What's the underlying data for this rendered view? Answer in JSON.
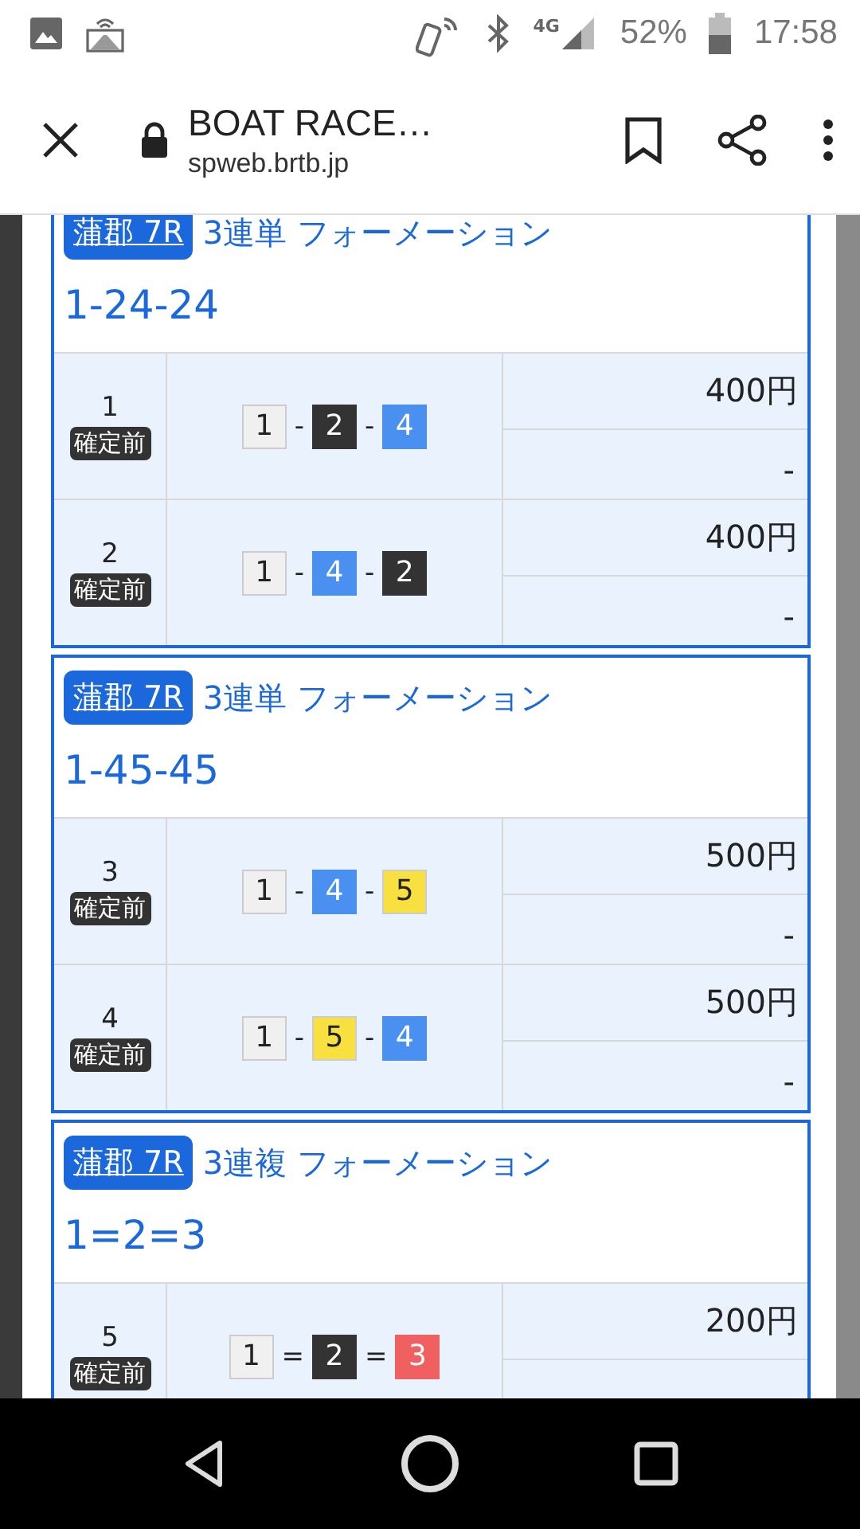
{
  "status_bar": {
    "network": "4G",
    "battery": "52%",
    "time": "17:58"
  },
  "toolbar": {
    "title": "BOAT RACE…",
    "url": "spweb.brtb.jp"
  },
  "cards": [
    {
      "race": "蒲郡 7R",
      "bet_type": "3連単 フォーメーション",
      "combination": "1-24-24",
      "rows": [
        {
          "number": "1",
          "status": "確定前",
          "separator": "-",
          "boats": [
            {
              "number": "1",
              "color": "#f0f0f0"
            },
            {
              "number": "2",
              "color": "#333333"
            },
            {
              "number": "4",
              "color": "#4a90f0"
            }
          ],
          "amount": "400円",
          "payout": "-"
        },
        {
          "number": "2",
          "status": "確定前",
          "separator": "-",
          "boats": [
            {
              "number": "1",
              "color": "#f0f0f0"
            },
            {
              "number": "4",
              "color": "#4a90f0"
            },
            {
              "number": "2",
              "color": "#333333"
            }
          ],
          "amount": "400円",
          "payout": "-"
        }
      ]
    },
    {
      "race": "蒲郡 7R",
      "bet_type": "3連単 フォーメーション",
      "combination": "1-45-45",
      "rows": [
        {
          "number": "3",
          "status": "確定前",
          "separator": "-",
          "boats": [
            {
              "number": "1",
              "color": "#f0f0f0"
            },
            {
              "number": "4",
              "color": "#4a90f0"
            },
            {
              "number": "5",
              "color": "#f8e040"
            }
          ],
          "amount": "500円",
          "payout": "-"
        },
        {
          "number": "4",
          "status": "確定前",
          "separator": "-",
          "boats": [
            {
              "number": "1",
              "color": "#f0f0f0"
            },
            {
              "number": "5",
              "color": "#f8e040"
            },
            {
              "number": "4",
              "color": "#4a90f0"
            }
          ],
          "amount": "500円",
          "payout": "-"
        }
      ]
    },
    {
      "race": "蒲郡 7R",
      "bet_type": "3連複 フォーメーション",
      "combination": "1=2=3",
      "rows": [
        {
          "number": "5",
          "status": "確定前",
          "separator": "=",
          "boats": [
            {
              "number": "1",
              "color": "#f0f0f0"
            },
            {
              "number": "2",
              "color": "#333333"
            },
            {
              "number": "3",
              "color": "#f06060"
            }
          ],
          "amount": "200円"
        }
      ]
    }
  ]
}
